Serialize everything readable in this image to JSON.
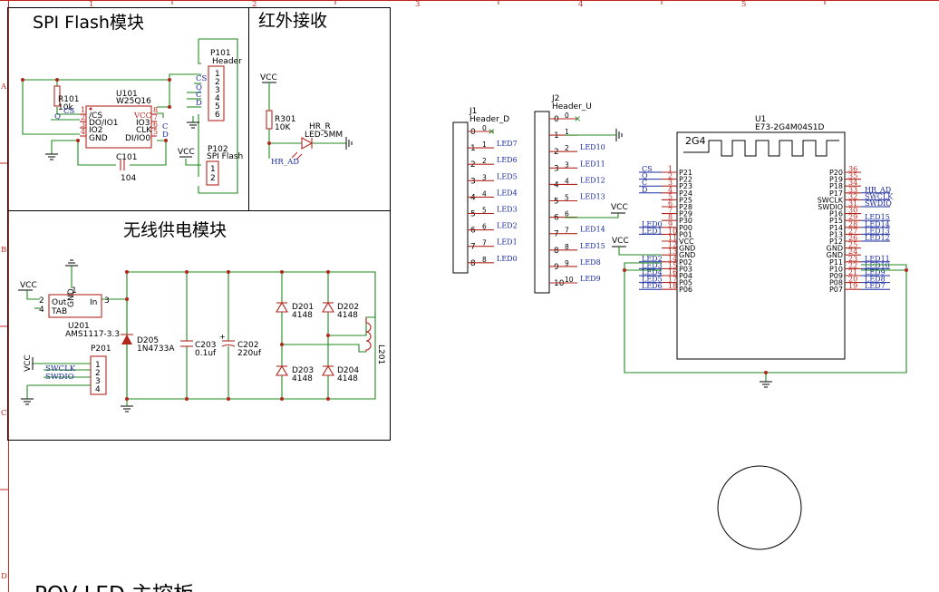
{
  "titles": {
    "spi": "SPI Flash模块",
    "ir": "红外接收",
    "wireless": "无线供电模块",
    "bottom": "POV LED 主控板"
  },
  "frame": {
    "cols": [
      "1",
      "2",
      "3",
      "4",
      "5"
    ],
    "rows": [
      "A",
      "B",
      "C",
      "D"
    ]
  },
  "spi": {
    "r101": {
      "ref": "R101",
      "val": "10k"
    },
    "u101": {
      "ref": "U101",
      "val": "W25Q16",
      "left_pins": [
        "/CS",
        "DO/IO1",
        "IO2",
        "GND"
      ],
      "right_pins": [
        "VCC",
        "IO3",
        "CLK",
        "DI/IO0"
      ],
      "left_nums": [
        "1",
        "2",
        "3",
        "4"
      ],
      "right_nums": [
        "8",
        "7",
        "6",
        "5"
      ]
    },
    "c101": {
      "ref": "C101",
      "val": "104"
    },
    "p101": {
      "ref": "P101",
      "val": "Header",
      "nums": [
        "1",
        "2",
        "3",
        "4",
        "5",
        "6"
      ],
      "nets": [
        "CS",
        "Q",
        "C",
        "D"
      ]
    },
    "p102": {
      "ref": "P102",
      "val": "SPI Flash",
      "nums": [
        "1",
        "2"
      ]
    },
    "nets_left": {
      "cs": "CS",
      "q": "Q"
    },
    "nets_right": {
      "c": "C",
      "d": "D"
    },
    "vcc": "VCC"
  },
  "ir": {
    "vcc": "VCC",
    "r301": {
      "ref": "R301",
      "val": "10K"
    },
    "led": {
      "ref": "HR_R",
      "val": "LED-5MM"
    },
    "net": "HR_AD"
  },
  "wireless": {
    "vcc": "VCC",
    "u201": {
      "ref": "U201",
      "val": "AMS1117-3.3",
      "out": "Out",
      "tab": "TAB",
      "in": "In",
      "gnd": "GND",
      "n2": "2",
      "n4": "4",
      "n1": "1",
      "n3": "3"
    },
    "d205": {
      "ref": "D205",
      "val": "1N4733A"
    },
    "c203": {
      "ref": "C203",
      "val": "0.1uf"
    },
    "c202": {
      "ref": "C202",
      "val": "220uf"
    },
    "d201": {
      "ref": "D201",
      "val": "4148"
    },
    "d202": {
      "ref": "D202",
      "val": "4148"
    },
    "d203": {
      "ref": "D203",
      "val": "4148"
    },
    "d204": {
      "ref": "D204",
      "val": "4148"
    },
    "l201": {
      "ref": "L201"
    },
    "p201": {
      "ref": "P201",
      "nums": [
        "1",
        "2",
        "3",
        "4"
      ],
      "nets": [
        "SWCLK",
        "SWDIO"
      ],
      "vcc": "VCC"
    }
  },
  "j1": {
    "ref": "J1",
    "val": "Header_D",
    "pins": [
      "0",
      "1",
      "2",
      "3",
      "4",
      "5",
      "6",
      "7",
      "8"
    ],
    "nums": [
      "0",
      "1",
      "2",
      "3",
      "4",
      "5",
      "6",
      "7",
      "8"
    ],
    "nets": [
      "LED7",
      "LED6",
      "LED5",
      "LED4",
      "LED3",
      "LED2",
      "LED1",
      "LED0"
    ]
  },
  "j2": {
    "ref": "J2",
    "val": "Header_U",
    "pins": [
      "0",
      "1",
      "2",
      "3",
      "4",
      "5",
      "6",
      "7",
      "8",
      "9",
      "10"
    ],
    "nums": [
      "0",
      "1",
      "2",
      "3",
      "4",
      "5",
      "6",
      "7",
      "8",
      "9",
      "10"
    ],
    "nets": [
      "LED10",
      "LED11",
      "LED12",
      "LED13",
      "LED14",
      "LED15",
      "LED8",
      "LED9"
    ],
    "vcc": "VCC"
  },
  "u1": {
    "ref": "U1",
    "val": "E73-2G4M04S1D",
    "antenna": "2G4",
    "left_pins": [
      "P21",
      "P22",
      "P23",
      "P24",
      "P25",
      "P28",
      "P29",
      "P30",
      "P00",
      "P01",
      "VCC",
      "GND",
      "GND",
      "P02",
      "P03",
      "P04",
      "P05",
      "P06"
    ],
    "left_nums": [
      "1",
      "2",
      "3",
      "4",
      "5",
      "6",
      "7",
      "8",
      "9",
      "10",
      "11",
      "12",
      "13",
      "14",
      "15",
      "16",
      "17",
      "18"
    ],
    "right_pins": [
      "P20",
      "P19",
      "P18",
      "P17",
      "SWCLK",
      "SWDIO",
      "P16",
      "P15",
      "P14",
      "P13",
      "P12",
      "GND",
      "GND",
      "P11",
      "P10",
      "P09",
      "P08",
      "P07"
    ],
    "right_nums": [
      "36",
      "35",
      "34",
      "33",
      "32",
      "31",
      "30",
      "29",
      "28",
      "27",
      "26",
      "25",
      "24",
      "23",
      "22",
      "21",
      "20",
      "19"
    ],
    "left_nets": [
      "CS",
      "Q",
      "C",
      "D",
      "",
      "",
      "",
      "",
      "LED0",
      "LED1",
      "",
      "",
      "",
      "LED2",
      "LED3",
      "LED4",
      "LED5",
      "LED6"
    ],
    "right_nets": [
      "",
      "",
      "",
      "HR_AD",
      "SWCLK",
      "SWDIO",
      "",
      "LED15",
      "LED14",
      "LED13",
      "LED12",
      "",
      "",
      "LED11",
      "LED10",
      "LED9",
      "LED8",
      "LED7"
    ],
    "vcc": "VCC"
  },
  "colors": {
    "wire": "#1f8a1f",
    "pin": "#b3261e",
    "net": "#1a2aa0",
    "frame": "#c0261e"
  }
}
